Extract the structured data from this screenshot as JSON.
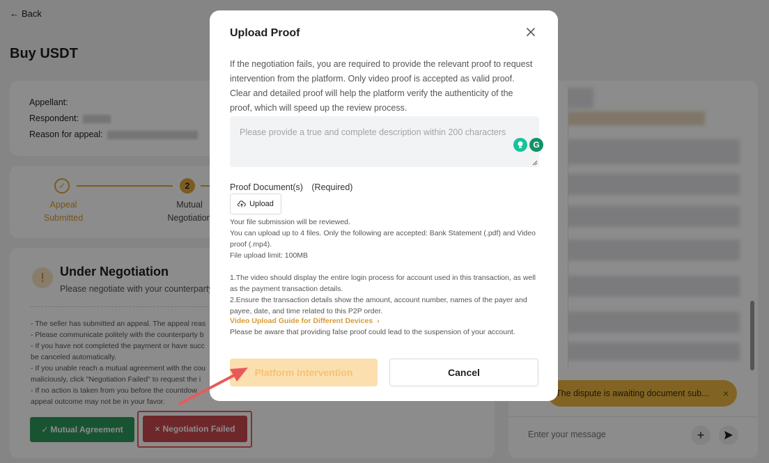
{
  "header": {
    "back_label": "Back",
    "page_title": "Buy USDT"
  },
  "appeal_info": {
    "appellant_label": "Appellant:",
    "respondent_label": "Respondent:",
    "reason_label": "Reason for appeal:"
  },
  "steps": [
    {
      "label": "Appeal Submitted",
      "status": "done"
    },
    {
      "number": "2",
      "label": "Mutual Negotiation",
      "status": "current"
    }
  ],
  "negotiation": {
    "title": "Under Negotiation",
    "subtitle": "Please negotiate with your counterparty",
    "text": "- The seller has submitted an appeal. The appeal reas\n- Please communicate politely with the counterparty b\n- If you have not completed the payment or have succ\nbe canceled automatically.\n- If you unable reach a mutual agreement with the cou\nmaliciously, click \"Negotiation Failed\" to request the i\n- If no action is taken from you before the countdow\nappeal outcome may not be in your favor.",
    "mutual_button": "Mutual Agreement",
    "failed_button": "Negotiation Failed"
  },
  "chat": {
    "toast_text": "The dispute is awaiting document sub...",
    "input_placeholder": "Enter your message"
  },
  "modal": {
    "title": "Upload Proof",
    "intro": "If the negotiation fails, you are required to provide the relevant proof to request intervention from the platform. Only video proof is accepted as valid proof. Clear and detailed proof will help the platform verify the authenticity of the proof, which will speed up the review process.",
    "description_placeholder": "Please provide a true and complete description within 200 characters",
    "proof_label": "Proof Document(s)　(Required)",
    "upload_button": "Upload",
    "upload_info": "Your file submission will be reviewed.\nYou can upload up to 4 files. Only the following are accepted: Bank Statement (.pdf) and Video proof (.mp4).\nFile upload limit: 100MB\n\n1.The video should display the entire login process for account used in this transaction, as well as the payment transaction details.\n2.Ensure the transaction details show the amount, account number, names of the payer and payee, date, and time related to this P2P order.",
    "guide_link": "Video Upload Guide for Different Devices",
    "false_warning": "Please be aware that providing false proof could lead to the suspension of your account.",
    "platform_button": "Platform Intervention",
    "cancel_button": "Cancel"
  },
  "colors": {
    "accent": "#e0a63a",
    "success": "#2e9a5b",
    "danger": "#c94a4f",
    "annotation": "#e85a5a"
  }
}
